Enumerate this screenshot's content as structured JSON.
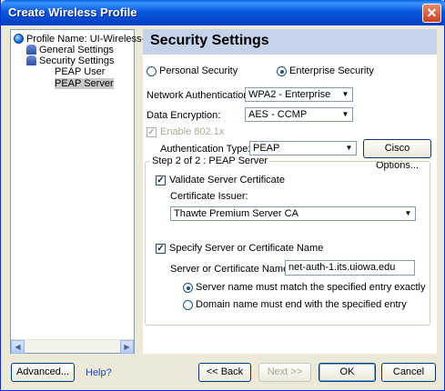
{
  "window": {
    "title": "Create Wireless Profile",
    "close_glyph": "✕"
  },
  "tree": {
    "items": [
      {
        "label": "Profile Name: UI-Wireless-WPA",
        "icon": "globe-icon"
      },
      {
        "label": "General Settings",
        "icon": "people-icon"
      },
      {
        "label": "Security Settings",
        "icon": "people-icon"
      },
      {
        "label": "PEAP User"
      },
      {
        "label": "PEAP Server"
      }
    ],
    "scroll_left": "◀",
    "scroll_right": "▶"
  },
  "security": {
    "header": "Security Settings",
    "personal_label": "Personal Security",
    "enterprise_label": "Enterprise Security",
    "network_auth_label": "Network Authentication:",
    "network_auth_value": "WPA2 - Enterprise",
    "data_encryption_label": "Data Encryption:",
    "data_encryption_value": "AES - CCMP",
    "enable_8021x_label": "Enable 802.1x",
    "auth_type_label": "Authentication Type:",
    "auth_type_value": "PEAP",
    "cisco_options": "Cisco Options...",
    "step_label": "Step 2 of 2 : PEAP Server",
    "validate_cert_label": "Validate Server Certificate",
    "cert_issuer_label": "Certificate Issuer:",
    "cert_issuer_value": "Thawte Premium Server CA",
    "specify_server_label": "Specify Server or Certificate Name",
    "server_name_label": "Server or Certificate Name:",
    "server_name_value": "net-auth-1.its.uiowa.edu",
    "match_exact_label": "Server name must match the specified entry exactly",
    "domain_end_label": "Domain name must end with the specified entry",
    "dropdown_glyph": "▼"
  },
  "footer": {
    "advanced": "Advanced...",
    "help": "Help?",
    "back": "<< Back",
    "next": "Next >>",
    "ok": "OK",
    "cancel": "Cancel"
  }
}
